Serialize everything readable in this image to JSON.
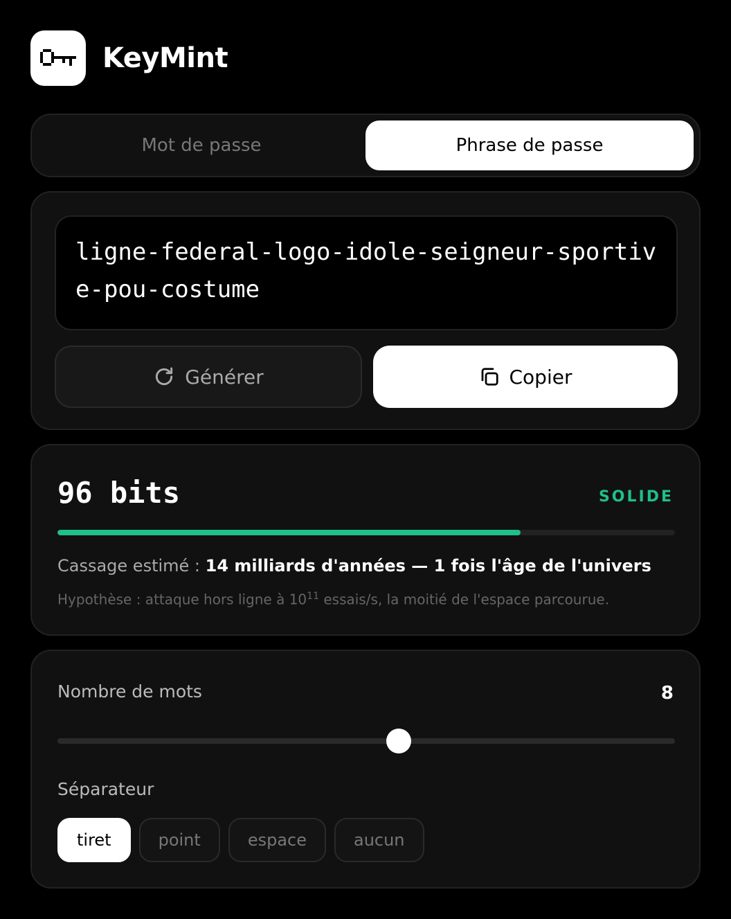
{
  "app": {
    "title": "KeyMint"
  },
  "tabs": [
    {
      "label": "Mot de passe",
      "active": false
    },
    {
      "label": "Phrase de passe",
      "active": true
    }
  ],
  "output": {
    "value": "ligne-federal-logo-idole-seigneur-sportive-pou-costume"
  },
  "actions": {
    "generate_label": "Générer",
    "copy_label": "Copier"
  },
  "strength": {
    "bits_label": "96 bits",
    "level_label": "SOLIDE",
    "meter_fraction": 0.75,
    "crack_prefix": "Cassage estimé :",
    "crack_value": "14 milliards d'années — 1 fois l'âge de l'univers",
    "hypothesis_pre": "Hypothèse : attaque hors ligne à 10",
    "hypothesis_exp": "11",
    "hypothesis_post": " essais/s, la moitié de l'espace parcourue."
  },
  "settings": {
    "word_count_label": "Nombre de mots",
    "word_count_value": "8",
    "slider_fraction": 0.553,
    "separator_label": "Séparateur",
    "separators": [
      {
        "label": "tiret",
        "active": true
      },
      {
        "label": "point",
        "active": false
      },
      {
        "label": "espace",
        "active": false
      },
      {
        "label": "aucun",
        "active": false
      }
    ]
  },
  "colors": {
    "accent": "#1fc08a",
    "background": "#000000",
    "card": "#111111"
  }
}
